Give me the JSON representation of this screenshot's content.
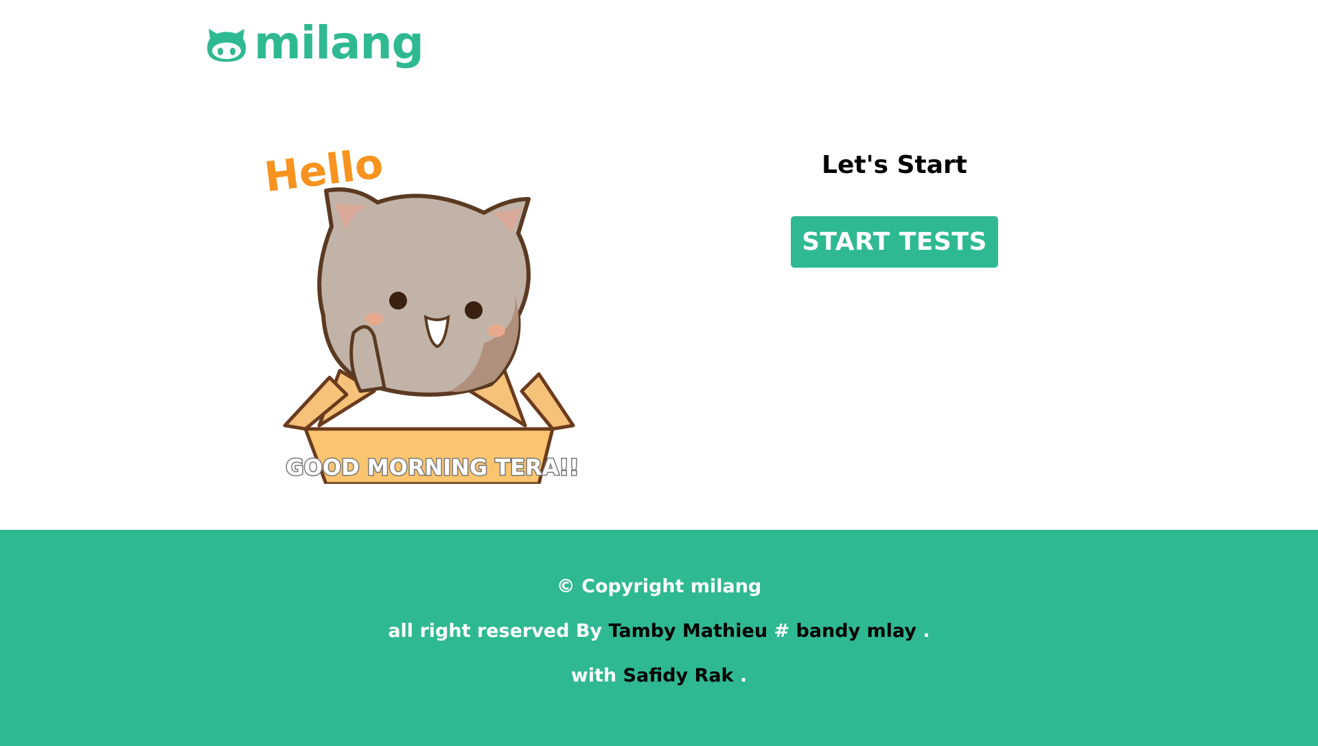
{
  "header": {
    "brand": "milang",
    "logo_icon": "github-cat-icon"
  },
  "hero": {
    "image_icon": "hello-cat-in-box-illustration",
    "hello_text": "Hello",
    "caption_text": "GOOD MORNING TERA!!"
  },
  "cta": {
    "title": "Let's Start",
    "button_label": "START TESTS"
  },
  "footer": {
    "copyright": "© Copyright milang",
    "reserved_prefix": "all right reserved By",
    "author1": "Tamby Mathieu",
    "separator": "#",
    "author2": "bandy mlay",
    "period1": ".",
    "with_prefix": "with",
    "author3": "Safidy Rak",
    "period2": "."
  },
  "colors": {
    "accent": "#2fb993",
    "footer_bg": "#2fb993",
    "text_dark": "#000000",
    "hello_orange": "#f7931e"
  }
}
